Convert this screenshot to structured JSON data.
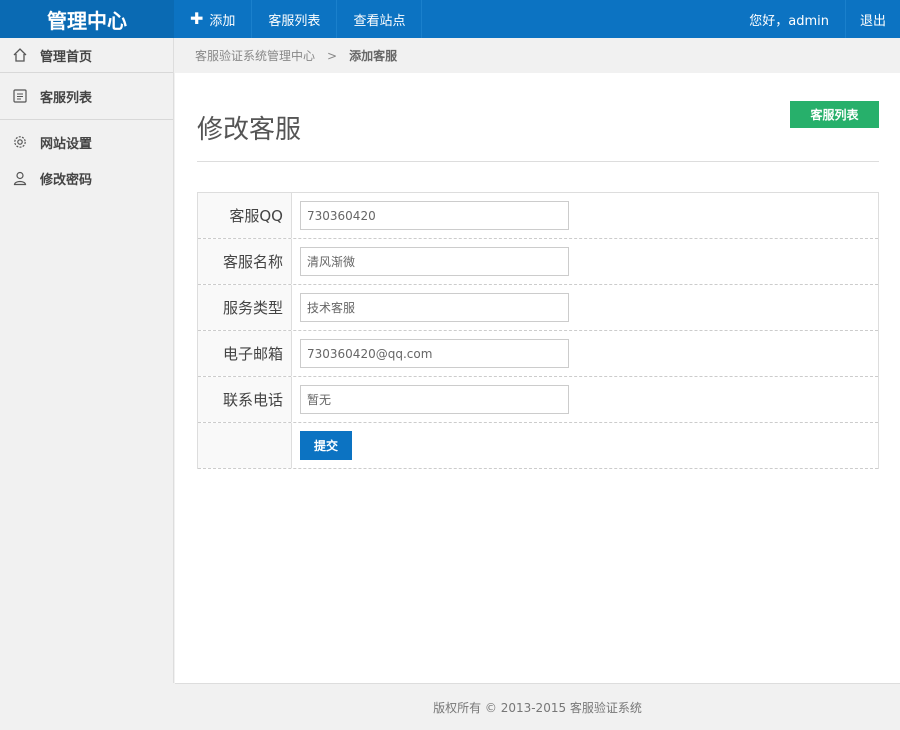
{
  "header": {
    "brand": "管理中心",
    "nav": [
      {
        "label": "添加",
        "icon": "plus-icon"
      },
      {
        "label": "客服列表"
      },
      {
        "label": "查看站点"
      }
    ],
    "greeting": "您好，admin",
    "logout": "退出"
  },
  "sidebar": {
    "items": [
      {
        "label": "管理首页",
        "icon": "home-icon"
      },
      {
        "label": "客服列表",
        "icon": "list-icon"
      },
      {
        "label": "网站设置",
        "icon": "gear-icon"
      },
      {
        "label": "修改密码",
        "icon": "user-icon"
      }
    ]
  },
  "breadcrumb": {
    "root": "客服验证系统管理中心",
    "separator": ">",
    "current": "添加客服"
  },
  "main": {
    "title": "修改客服",
    "list_button": "客服列表",
    "form": {
      "fields": [
        {
          "label": "客服QQ",
          "value": "730360420"
        },
        {
          "label": "客服名称",
          "value": "清风渐微"
        },
        {
          "label": "服务类型",
          "value": "技术客服"
        },
        {
          "label": "电子邮箱",
          "value": "730360420@qq.com"
        },
        {
          "label": "联系电话",
          "value": "暂无"
        }
      ],
      "submit_label": "提交"
    }
  },
  "footer": {
    "text": "版权所有 © 2013-2015 客服验证系统"
  },
  "colors": {
    "primary": "#0c73c2",
    "brand_bg": "#0a6ab3",
    "success": "#27b06b"
  }
}
